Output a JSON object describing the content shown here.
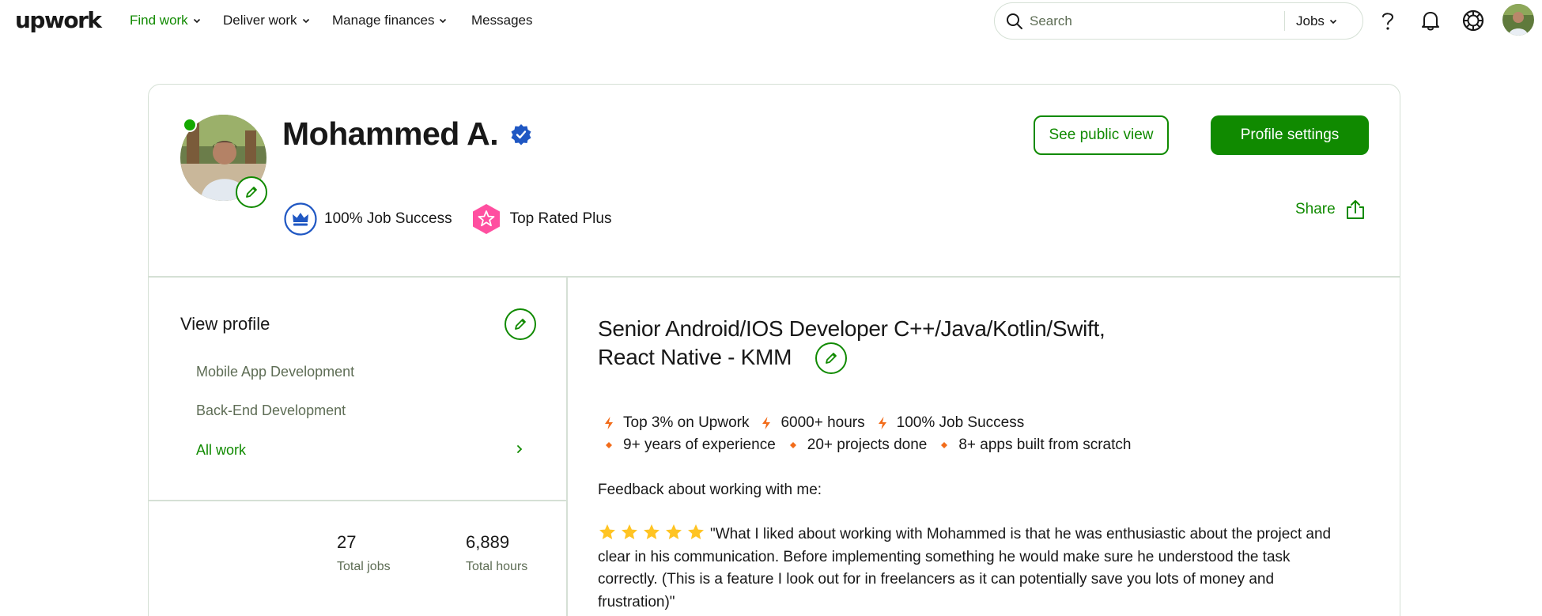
{
  "brand": {
    "logo_text": "upwork",
    "accent": "#108a00",
    "online": "#14a800"
  },
  "nav": {
    "items": [
      {
        "label": "Find work",
        "active": true
      },
      {
        "label": "Deliver work",
        "active": false
      },
      {
        "label": "Manage finances",
        "active": false
      },
      {
        "label": "Messages",
        "active": false
      }
    ]
  },
  "search": {
    "placeholder": "Search",
    "scope": "Jobs"
  },
  "top_icons": [
    "help-icon",
    "bell-icon",
    "settings-icon",
    "user-avatar"
  ],
  "profile": {
    "name": "Mohammed A.",
    "verified": true,
    "online": true,
    "badges": [
      {
        "label": "100% Job Success",
        "icon": "crown-icon",
        "color": "#1f57c3"
      },
      {
        "label": "Top Rated Plus",
        "icon": "star-badge-icon",
        "color": "#ff4fa0"
      }
    ],
    "see_public_view": "See public view",
    "profile_settings": "Profile settings",
    "share": "Share"
  },
  "sidebar": {
    "title": "View profile",
    "links": [
      {
        "label": "Mobile App Development"
      },
      {
        "label": "Back-End Development"
      },
      {
        "label": "All work"
      }
    ],
    "stats": [
      {
        "value": "27",
        "label": "Total jobs"
      },
      {
        "value": "6,889",
        "label": "Total hours"
      }
    ]
  },
  "main": {
    "headline_line1": "Senior Android/IOS Developer C++/Java/Kotlin/Swift,",
    "headline_line2": "React Native - KMM",
    "highlights_row1": [
      "Top 3% on Upwork",
      "6000+ hours",
      "100% Job Success"
    ],
    "highlights_row2": [
      "9+ years of experience",
      "20+ projects done",
      "8+ apps built from scratch"
    ],
    "feedback_intro": "Feedback about working with me:",
    "rating_stars": 5,
    "quote": "\"What I liked about working with Mohammed is that he was enthusiastic about the project and clear in his communication. Before implementing something he would make sure he understood the task correctly. (This is a feature I look out for in freelancers as it can potentially save you lots of money and frustration)\""
  }
}
